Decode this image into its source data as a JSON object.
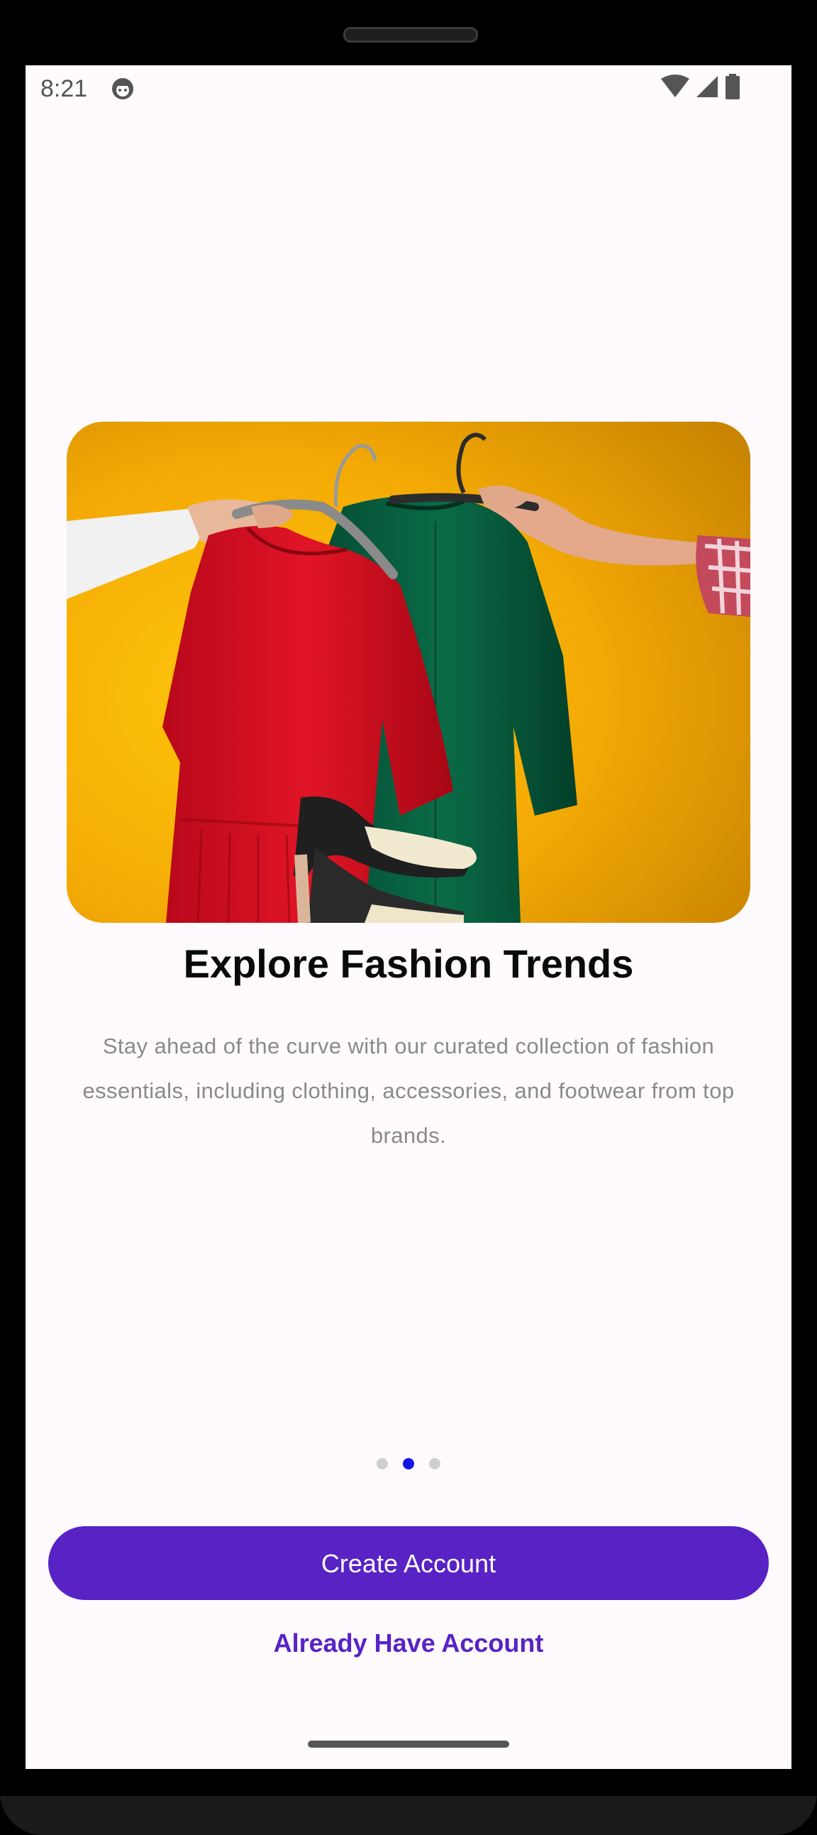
{
  "status_bar": {
    "time": "8:21",
    "icons": [
      "avatar-icon",
      "wifi-icon",
      "cellular-signal-icon",
      "battery-icon"
    ]
  },
  "onboarding": {
    "image": "fashion-dresses-image",
    "title": "Explore Fashion Trends",
    "description": "Stay ahead of the curve with our curated collection of fashion essentials, including clothing, accessories, and footwear from top brands.",
    "page_indicator": {
      "count": 3,
      "active_index": 1
    }
  },
  "actions": {
    "create_account_label": "Create Account",
    "already_have_account_label": "Already Have Account"
  },
  "colors": {
    "primary": "#5822c4",
    "active_dot": "#1414e6",
    "inactive_dot": "#cfcfcf",
    "background": "#fefafe"
  }
}
